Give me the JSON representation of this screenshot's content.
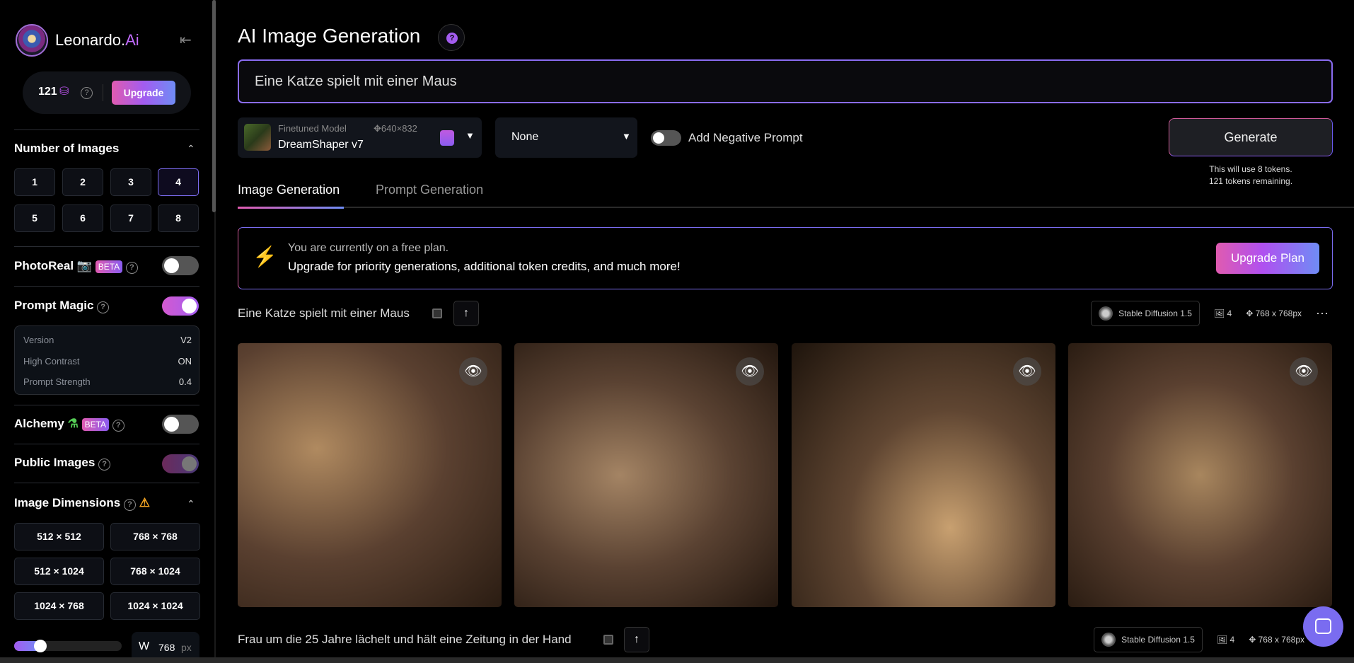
{
  "sidebar": {
    "brand": "Leonardo.",
    "brand_ai": "Ai",
    "tokens": "121",
    "upgrade": "Upgrade",
    "num_images": {
      "label": "Number of Images",
      "options": [
        "1",
        "2",
        "3",
        "4",
        "5",
        "6",
        "7",
        "8"
      ],
      "selected": "4"
    },
    "photoreal": {
      "label": "PhotoReal",
      "badge": "BETA",
      "on": false
    },
    "prompt_magic": {
      "label": "Prompt Magic",
      "on": true,
      "version_label": "Version",
      "version": "V2",
      "contrast_label": "High Contrast",
      "contrast": "ON",
      "strength_label": "Prompt Strength",
      "strength": "0.4"
    },
    "alchemy": {
      "label": "Alchemy",
      "badge": "BETA",
      "on": false
    },
    "public_images": {
      "label": "Public Images",
      "on": true
    },
    "dimensions": {
      "label": "Image Dimensions",
      "options": [
        "512 × 512",
        "768 × 768",
        "512 × 1024",
        "768 × 1024",
        "1024 × 768",
        "1024 × 1024"
      ],
      "selected": "768 × 768",
      "w_label": "W",
      "w_value": "768",
      "w_unit": "px",
      "slider_fraction": 0.2
    }
  },
  "header": {
    "title": "AI Image Generation",
    "prompt": "Eine Katze spielt mit einer Maus"
  },
  "controls": {
    "model_caption": "Finetuned Model",
    "model_dims": "640×832",
    "model_name": "DreamShaper v7",
    "style": "None",
    "negative_label": "Add Negative Prompt",
    "generate": "Generate",
    "token_use": "This will use 8 tokens.",
    "token_remaining": "121 tokens remaining."
  },
  "tabs": [
    "Image Generation",
    "Prompt Generation"
  ],
  "banner": {
    "line1": "You are currently on a free plan.",
    "line2": "Upgrade for priority generations, additional token credits, and much more!",
    "button": "Upgrade Plan"
  },
  "generations": [
    {
      "prompt": "Eine Katze spielt mit einer Maus",
      "model": "Stable Diffusion 1.5",
      "count": "4",
      "size": "768 x 768px"
    },
    {
      "prompt": "Frau um die 25 Jahre lächelt und hält eine Zeitung in der Hand",
      "model": "Stable Diffusion 1.5",
      "count": "4",
      "size": "768 x 768px"
    }
  ],
  "colors": {
    "accent": "#a35cf0",
    "pink": "#e05bb0",
    "blue": "#6f8cf5"
  }
}
